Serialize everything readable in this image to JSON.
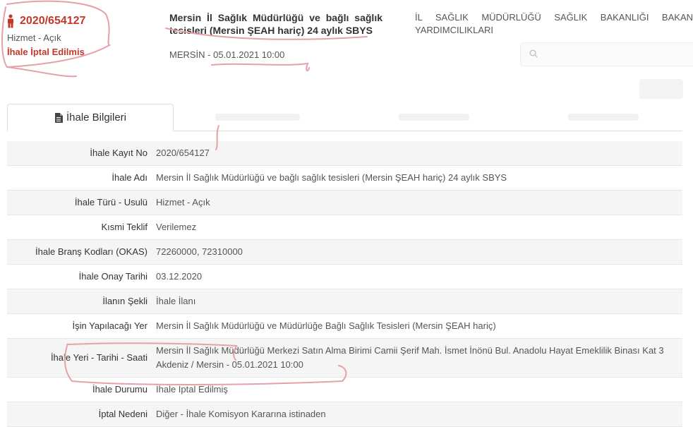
{
  "summary": {
    "tender_id": "2020/654127",
    "type": "Hizmet - Açık",
    "status": "İhale İptal Edilmiş"
  },
  "header": {
    "title": "Mersin İl Sağlık Müdürlüğü ve bağlı sağlık tesisleri (Mersin ŞEAH hariç) 24 aylık SBYS",
    "location_date": "MERSİN - 05.01.2021 10:00",
    "authority": "İL SAĞLIK MÜDÜRLÜĞÜ SAĞLIK BAKANLIĞI BAKAN YARDIMCILIKLARI"
  },
  "tabs": [
    {
      "label": "İhale Bilgileri",
      "active": true
    }
  ],
  "details": [
    {
      "label": "İhale Kayıt No",
      "value": "2020/654127"
    },
    {
      "label": "İhale Adı",
      "value": "Mersin İl Sağlık Müdürlüğü ve bağlı sağlık tesisleri (Mersin ŞEAH hariç) 24 aylık SBYS"
    },
    {
      "label": "İhale Türü - Usulü",
      "value": "Hizmet - Açık"
    },
    {
      "label": "Kısmi Teklif",
      "value": "Verilemez"
    },
    {
      "label": "İhale Branş Kodları (OKAS)",
      "value": "72260000, 72310000"
    },
    {
      "label": "İhale Onay Tarihi",
      "value": "03.12.2020"
    },
    {
      "label": "İlanın Şekli",
      "value": "İhale İlanı"
    },
    {
      "label": "İşin Yapılacağı Yer",
      "value": "Mersin İl Sağlık Müdürlüğü ve Müdürlüğe Bağlı Sağlık Tesisleri (Mersin ŞEAH hariç)"
    },
    {
      "label": "İhale Yeri - Tarihi - Saati",
      "value": "Mersin İl Sağlık Müdürlüğü Merkezi Satın Alma Birimi Camii Şerif Mah. İsmet İnönü Bul. Anadolu Hayat Emeklilik Binası Kat 3 Akdeniz / Mersin - 05.01.2021 10:00"
    },
    {
      "label": "İhale Durumu",
      "value": "İhale İptal Edilmiş"
    },
    {
      "label": "İptal Nedeni",
      "value": "Diğer - İhale Komisyon Kararına istinaden"
    }
  ],
  "colors": {
    "accent": "#c0392b",
    "annotation": "#e8a0a8"
  }
}
